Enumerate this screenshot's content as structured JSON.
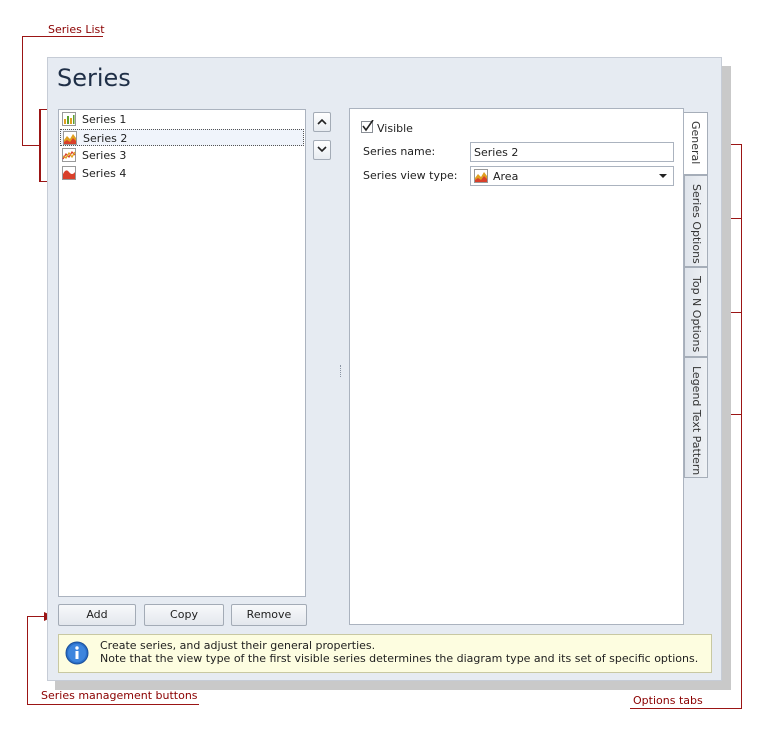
{
  "annotations": {
    "series_list": "Series List",
    "management_buttons": "Series management buttons",
    "options_tabs": "Options tabs"
  },
  "dialog": {
    "title": "Series"
  },
  "series_list": {
    "items": [
      {
        "label": "Series 1",
        "icon": "bar-chart-icon",
        "selected": false
      },
      {
        "label": "Series 2",
        "icon": "area-chart-icon",
        "selected": true
      },
      {
        "label": "Series 3",
        "icon": "line-chart-icon",
        "selected": false
      },
      {
        "label": "Series 4",
        "icon": "spline-area-chart-icon",
        "selected": false
      }
    ]
  },
  "general": {
    "visible_label": "Visible",
    "visible_checked": true,
    "series_name_label": "Series name:",
    "series_name_value": "Series 2",
    "view_type_label": "Series view type:",
    "view_type_value": "Area"
  },
  "tabs": [
    {
      "label": "General",
      "active": true
    },
    {
      "label": "Series Options",
      "active": false
    },
    {
      "label": "Top N Options",
      "active": false
    },
    {
      "label": "Legend Text Pattern",
      "active": false
    }
  ],
  "buttons": {
    "add": "Add",
    "copy": "Copy",
    "remove": "Remove"
  },
  "info": {
    "line1": "Create series, and adjust their general properties.",
    "line2": "Note that the view type of the first visible series determines the diagram type and its set of specific options."
  },
  "colors": {
    "annotation": "#9b1515",
    "window_bg": "#e6ebf2",
    "info_bg": "#fdfde0"
  }
}
